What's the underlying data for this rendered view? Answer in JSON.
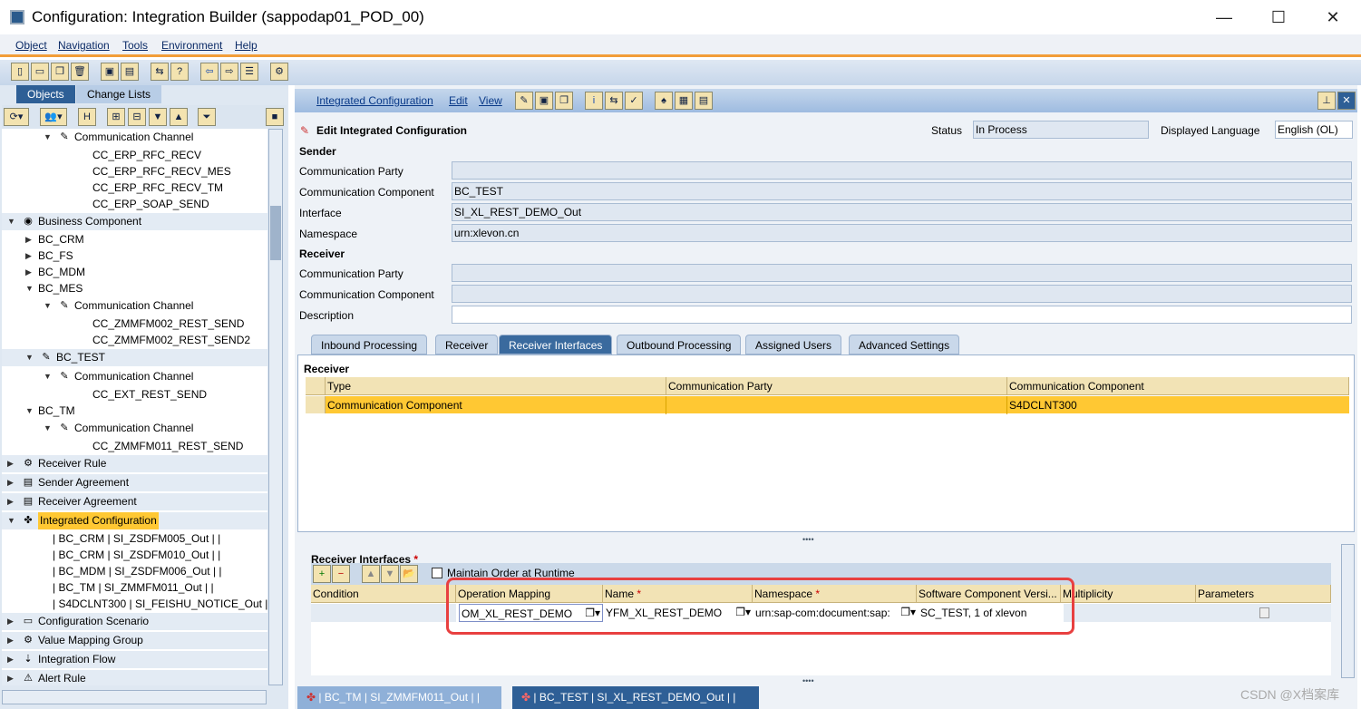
{
  "window": {
    "title": "Configuration: Integration Builder (sappodap01_POD_00)",
    "minimize": "—",
    "maximize": "☐",
    "close": "✕"
  },
  "menu": [
    "Object",
    "Navigation",
    "Tools",
    "Environment",
    "Help"
  ],
  "left": {
    "tabs": [
      "Objects",
      "Change Lists"
    ],
    "tree": [
      {
        "label": "Communication Channel",
        "level": 2,
        "exp": "open",
        "icon": "channel"
      },
      {
        "label": "CC_ERP_RFC_RECV",
        "level": 3
      },
      {
        "label": "CC_ERP_RFC_RECV_MES",
        "level": 3
      },
      {
        "label": "CC_ERP_RFC_RECV_TM",
        "level": 3
      },
      {
        "label": "CC_ERP_SOAP_SEND",
        "level": 3
      },
      {
        "label": "Business Component",
        "level": 0,
        "exp": "open",
        "icon": "component",
        "grp": true
      },
      {
        "label": "BC_CRM",
        "level": 1,
        "exp": "closed"
      },
      {
        "label": "BC_FS",
        "level": 1,
        "exp": "closed"
      },
      {
        "label": "BC_MDM",
        "level": 1,
        "exp": "closed"
      },
      {
        "label": "BC_MES",
        "level": 1,
        "exp": "open"
      },
      {
        "label": "Communication Channel",
        "level": 2,
        "exp": "open",
        "icon": "channel"
      },
      {
        "label": "CC_ZMMFM002_REST_SEND",
        "level": 3
      },
      {
        "label": "CC_ZMMFM002_REST_SEND2",
        "level": 3
      },
      {
        "label": "BC_TEST",
        "level": 1,
        "exp": "open",
        "icon": "edit",
        "grp": true
      },
      {
        "label": "Communication Channel",
        "level": 2,
        "exp": "open",
        "icon": "channel"
      },
      {
        "label": "CC_EXT_REST_SEND",
        "level": 3
      },
      {
        "label": "BC_TM",
        "level": 1,
        "exp": "open"
      },
      {
        "label": "Communication Channel",
        "level": 2,
        "exp": "open",
        "icon": "channel"
      },
      {
        "label": "CC_ZMMFM011_REST_SEND",
        "level": 3
      },
      {
        "label": "Receiver Rule",
        "level": 0,
        "exp": "closed",
        "icon": "rule",
        "grp": true
      },
      {
        "label": "Sender Agreement",
        "level": 0,
        "exp": "closed",
        "icon": "agreement",
        "grp": true
      },
      {
        "label": "Receiver Agreement",
        "level": 0,
        "exp": "closed",
        "icon": "agreement",
        "grp": true
      },
      {
        "label": "Integrated Configuration",
        "level": 0,
        "exp": "open",
        "icon": "config",
        "grp": true,
        "sel": true
      },
      {
        "label": "| BC_CRM | SI_ZSDFM005_Out |  |",
        "level": 4
      },
      {
        "label": "| BC_CRM | SI_ZSDFM010_Out |  |",
        "level": 4
      },
      {
        "label": "| BC_MDM | SI_ZSDFM006_Out |  |",
        "level": 4
      },
      {
        "label": "| BC_TM | SI_ZMMFM011_Out |  |",
        "level": 4
      },
      {
        "label": "| S4DCLNT300 | SI_FEISHU_NOTICE_Out |  |",
        "level": 4
      },
      {
        "label": "Configuration Scenario",
        "level": 0,
        "exp": "closed",
        "icon": "scenario",
        "grp": true
      },
      {
        "label": "Value Mapping Group",
        "level": 0,
        "exp": "closed",
        "icon": "vmg",
        "grp": true
      },
      {
        "label": "Integration Flow",
        "level": 0,
        "exp": "closed",
        "icon": "flow",
        "grp": true
      },
      {
        "label": "Alert Rule",
        "level": 0,
        "exp": "closed",
        "icon": "alert",
        "grp": true
      }
    ]
  },
  "right": {
    "menu": [
      "Integrated Configuration",
      "Edit",
      "View"
    ],
    "title": "Edit Integrated Configuration",
    "status_label": "Status",
    "status": "In Process",
    "lang_label": "Displayed Language",
    "lang": "English (OL)",
    "sender": {
      "heading": "Sender",
      "fields": [
        {
          "label": "Communication Party",
          "value": ""
        },
        {
          "label": "Communication Component",
          "value": "BC_TEST"
        },
        {
          "label": "Interface",
          "value": "SI_XL_REST_DEMO_Out"
        },
        {
          "label": "Namespace",
          "value": "urn:xlevon.cn"
        }
      ]
    },
    "receiver": {
      "heading": "Receiver",
      "fields": [
        {
          "label": "Communication Party",
          "value": ""
        },
        {
          "label": "Communication Component",
          "value": ""
        },
        {
          "label": "Description",
          "value": ""
        }
      ]
    },
    "tabs": [
      "Inbound Processing",
      "Receiver",
      "Receiver Interfaces",
      "Outbound Processing",
      "Assigned Users",
      "Advanced Settings"
    ],
    "active_tab": "Receiver Interfaces",
    "receiver_table": {
      "heading": "Receiver",
      "columns": [
        "Type",
        "Communication Party",
        "Communication Component"
      ],
      "rows": [
        [
          "Communication Component",
          "",
          "S4DCLNT300"
        ]
      ]
    },
    "ri": {
      "heading": "Receiver Interfaces",
      "required": "*",
      "maintain_order": "Maintain Order at Runtime",
      "maintain_order_checked": false,
      "columns": [
        {
          "label": "Condition"
        },
        {
          "label": "Operation Mapping"
        },
        {
          "label": "Name",
          "req": "*"
        },
        {
          "label": "Namespace",
          "req": "*"
        },
        {
          "label": "Software Component Versi..."
        },
        {
          "label": "Multiplicity"
        },
        {
          "label": "Parameters"
        }
      ],
      "row": {
        "condition": "",
        "operation_mapping": "OM_XL_REST_DEMO",
        "name": "YFM_XL_REST_DEMO",
        "namespace": "urn:sap-com:document:sap:",
        "scv": "SC_TEST, 1 of xlevon",
        "multiplicity": "",
        "parameters": false
      }
    },
    "highlight_color": "#e84040"
  },
  "bottom_tabs": [
    "| BC_TM | SI_ZMMFM011_Out |  |",
    "| BC_TEST | SI_XL_REST_DEMO_Out |  |"
  ],
  "watermark": "CSDN @X档案库"
}
